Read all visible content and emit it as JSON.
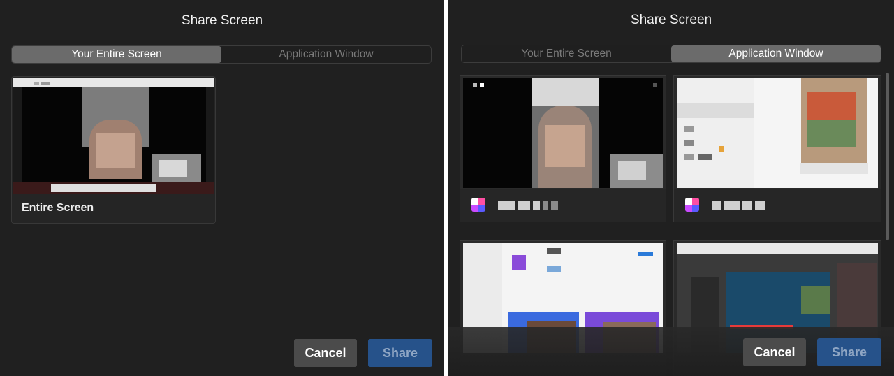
{
  "left_dialog": {
    "title": "Share Screen",
    "tabs": [
      {
        "label": "Your Entire Screen",
        "active": true
      },
      {
        "label": "Application Window",
        "active": false
      }
    ],
    "screens": [
      {
        "label": "Entire Screen"
      }
    ],
    "buttons": {
      "cancel": "Cancel",
      "share": "Share"
    }
  },
  "right_dialog": {
    "title": "Share Screen",
    "tabs": [
      {
        "label": "Your Entire Screen",
        "active": false
      },
      {
        "label": "Application Window",
        "active": true
      }
    ],
    "windows": [
      {
        "icon": "app-icon",
        "title_redacted": true
      },
      {
        "icon": "app-icon",
        "title_redacted": true
      },
      {
        "icon": "app-icon",
        "title_redacted": true
      },
      {
        "icon": "app-icon",
        "title_redacted": true
      }
    ],
    "buttons": {
      "cancel": "Cancel",
      "share": "Share"
    }
  },
  "colors": {
    "dialog_bg": "#202020",
    "tab_active": "#6b6b6b",
    "cancel_bg": "#4b4b4b",
    "share_bg": "#26528a",
    "share_text": "#8fa6c4"
  }
}
